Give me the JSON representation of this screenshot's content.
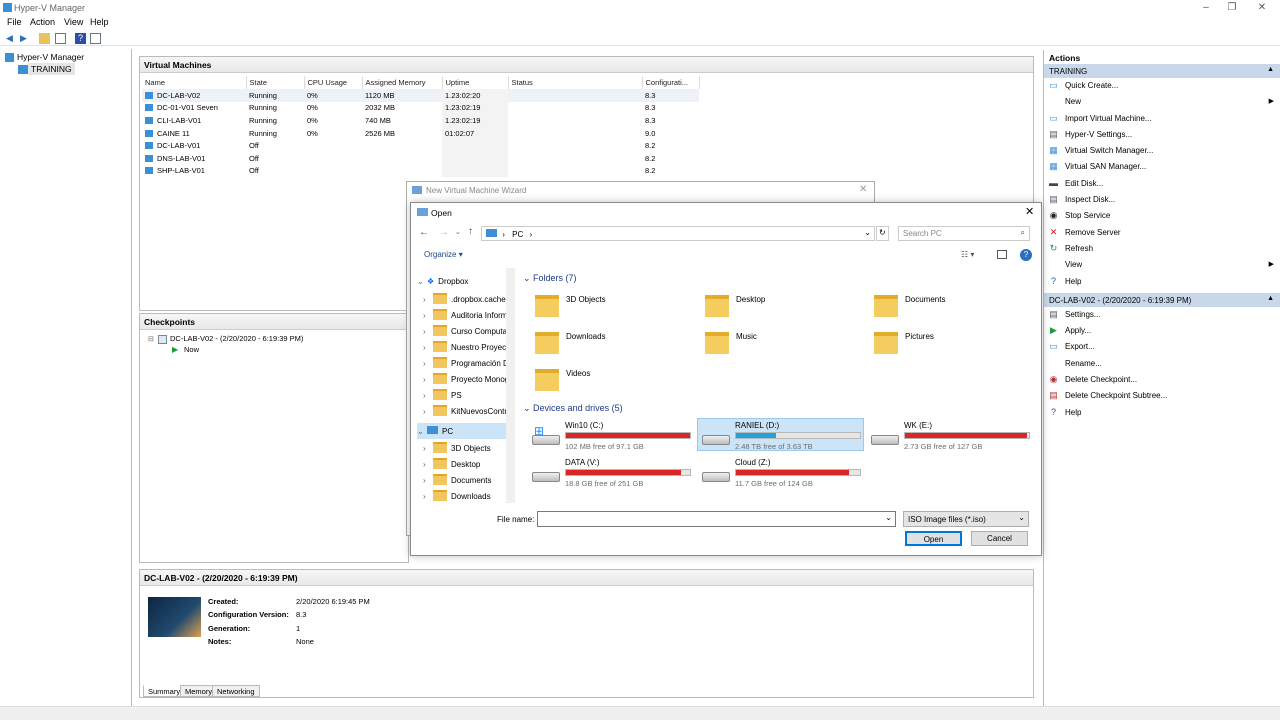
{
  "window": {
    "title": "Hyper-V Manager"
  },
  "menu": [
    "File",
    "Action",
    "View",
    "Help"
  ],
  "tree": {
    "root": "Hyper-V Manager",
    "server": "TRAINING"
  },
  "vm_panel": {
    "title": "Virtual Machines",
    "columns": [
      "Name",
      "State",
      "CPU Usage",
      "Assigned Memory",
      "Uptime",
      "Status",
      "Configurati..."
    ],
    "rows": [
      [
        "DC-LAB-V02",
        "Running",
        "0%",
        "1120 MB",
        "1.23:02:20",
        "",
        "8.3"
      ],
      [
        "DC-01-V01 Seven",
        "Running",
        "0%",
        "2032 MB",
        "1.23:02:19",
        "",
        "8.3"
      ],
      [
        "CLI-LAB-V01",
        "Running",
        "0%",
        "740 MB",
        "1.23:02:19",
        "",
        "8.3"
      ],
      [
        "CAINE 11",
        "Running",
        "0%",
        "2526 MB",
        "01:02:07",
        "",
        "9.0"
      ],
      [
        "DC-LAB-V01",
        "Off",
        "",
        "",
        "",
        "",
        "8.2"
      ],
      [
        "DNS-LAB-V01",
        "Off",
        "",
        "",
        "",
        "",
        "8.2"
      ],
      [
        "SHP-LAB-V01",
        "Off",
        "",
        "",
        "",
        "",
        "8.2"
      ]
    ]
  },
  "checkpoints": {
    "title": "Checkpoints",
    "item": "DC-LAB-V02 - (2/20/2020 - 6:19:39 PM)",
    "now": "Now"
  },
  "details": {
    "title": "DC-LAB-V02 - (2/20/2020 - 6:19:39 PM)",
    "created_label": "Created:",
    "created": "2/20/2020 6:19:45 PM",
    "config_label": "Configuration Version:",
    "config": "8.3",
    "gen_label": "Generation:",
    "gen": "1",
    "notes_label": "Notes:",
    "notes": "None",
    "tabs": [
      "Summary",
      "Memory",
      "Networking"
    ]
  },
  "actions": {
    "title": "Actions",
    "section1": "TRAINING",
    "items1": [
      "Quick Create...",
      "New",
      "Import Virtual Machine...",
      "Hyper-V Settings...",
      "Virtual Switch Manager...",
      "Virtual SAN Manager...",
      "Edit Disk...",
      "Inspect Disk...",
      "Stop Service",
      "Remove Server",
      "Refresh",
      "View",
      "Help"
    ],
    "section2": "DC-LAB-V02 - (2/20/2020 - 6:19:39 PM)",
    "items2": [
      "Settings...",
      "Apply...",
      "Export...",
      "Rename...",
      "Delete Checkpoint...",
      "Delete Checkpoint Subtree...",
      "Help"
    ]
  },
  "wizard": {
    "title": "New Virtual Machine Wizard"
  },
  "dialog": {
    "title": "Open",
    "path": "PC",
    "search_placeholder": "Search PC",
    "organize": "Organize",
    "nav": [
      "Dropbox",
      ".dropbox.cache",
      "Auditoria Inform",
      "Curso Computac",
      "Nuestro Proyect",
      "Programación D",
      "Proyecto Monog",
      "PS",
      "KitNuevosContri",
      "PC",
      "3D Objects",
      "Desktop",
      "Documents",
      "Downloads"
    ],
    "folders_header": "Folders (7)",
    "folders": [
      "3D Objects",
      "Desktop",
      "Documents",
      "Downloads",
      "Music",
      "Pictures",
      "Videos"
    ],
    "drives_header": "Devices and drives (5)",
    "drives": [
      {
        "name": "Win10 (C:)",
        "free": "102 MB free of 97.1 GB",
        "used_fraction": 0.999,
        "color": "#da2626"
      },
      {
        "name": "RANIEL (D:)",
        "free": "2.48 TB free of 3.63 TB",
        "used_fraction": 0.32,
        "color": "#26a0da"
      },
      {
        "name": "WK (E:)",
        "free": "2.73 GB free of 127 GB",
        "used_fraction": 0.98,
        "color": "#da2626"
      },
      {
        "name": "DATA (V:)",
        "free": "18.8 GB free of 251 GB",
        "used_fraction": 0.93,
        "color": "#da2626"
      },
      {
        "name": "Cloud (Z:)",
        "free": "11.7 GB free of 124 GB",
        "used_fraction": 0.91,
        "color": "#da2626"
      }
    ],
    "filename_label": "File name:",
    "filetype": "ISO Image files   (*.iso)",
    "open": "Open",
    "cancel": "Cancel"
  }
}
